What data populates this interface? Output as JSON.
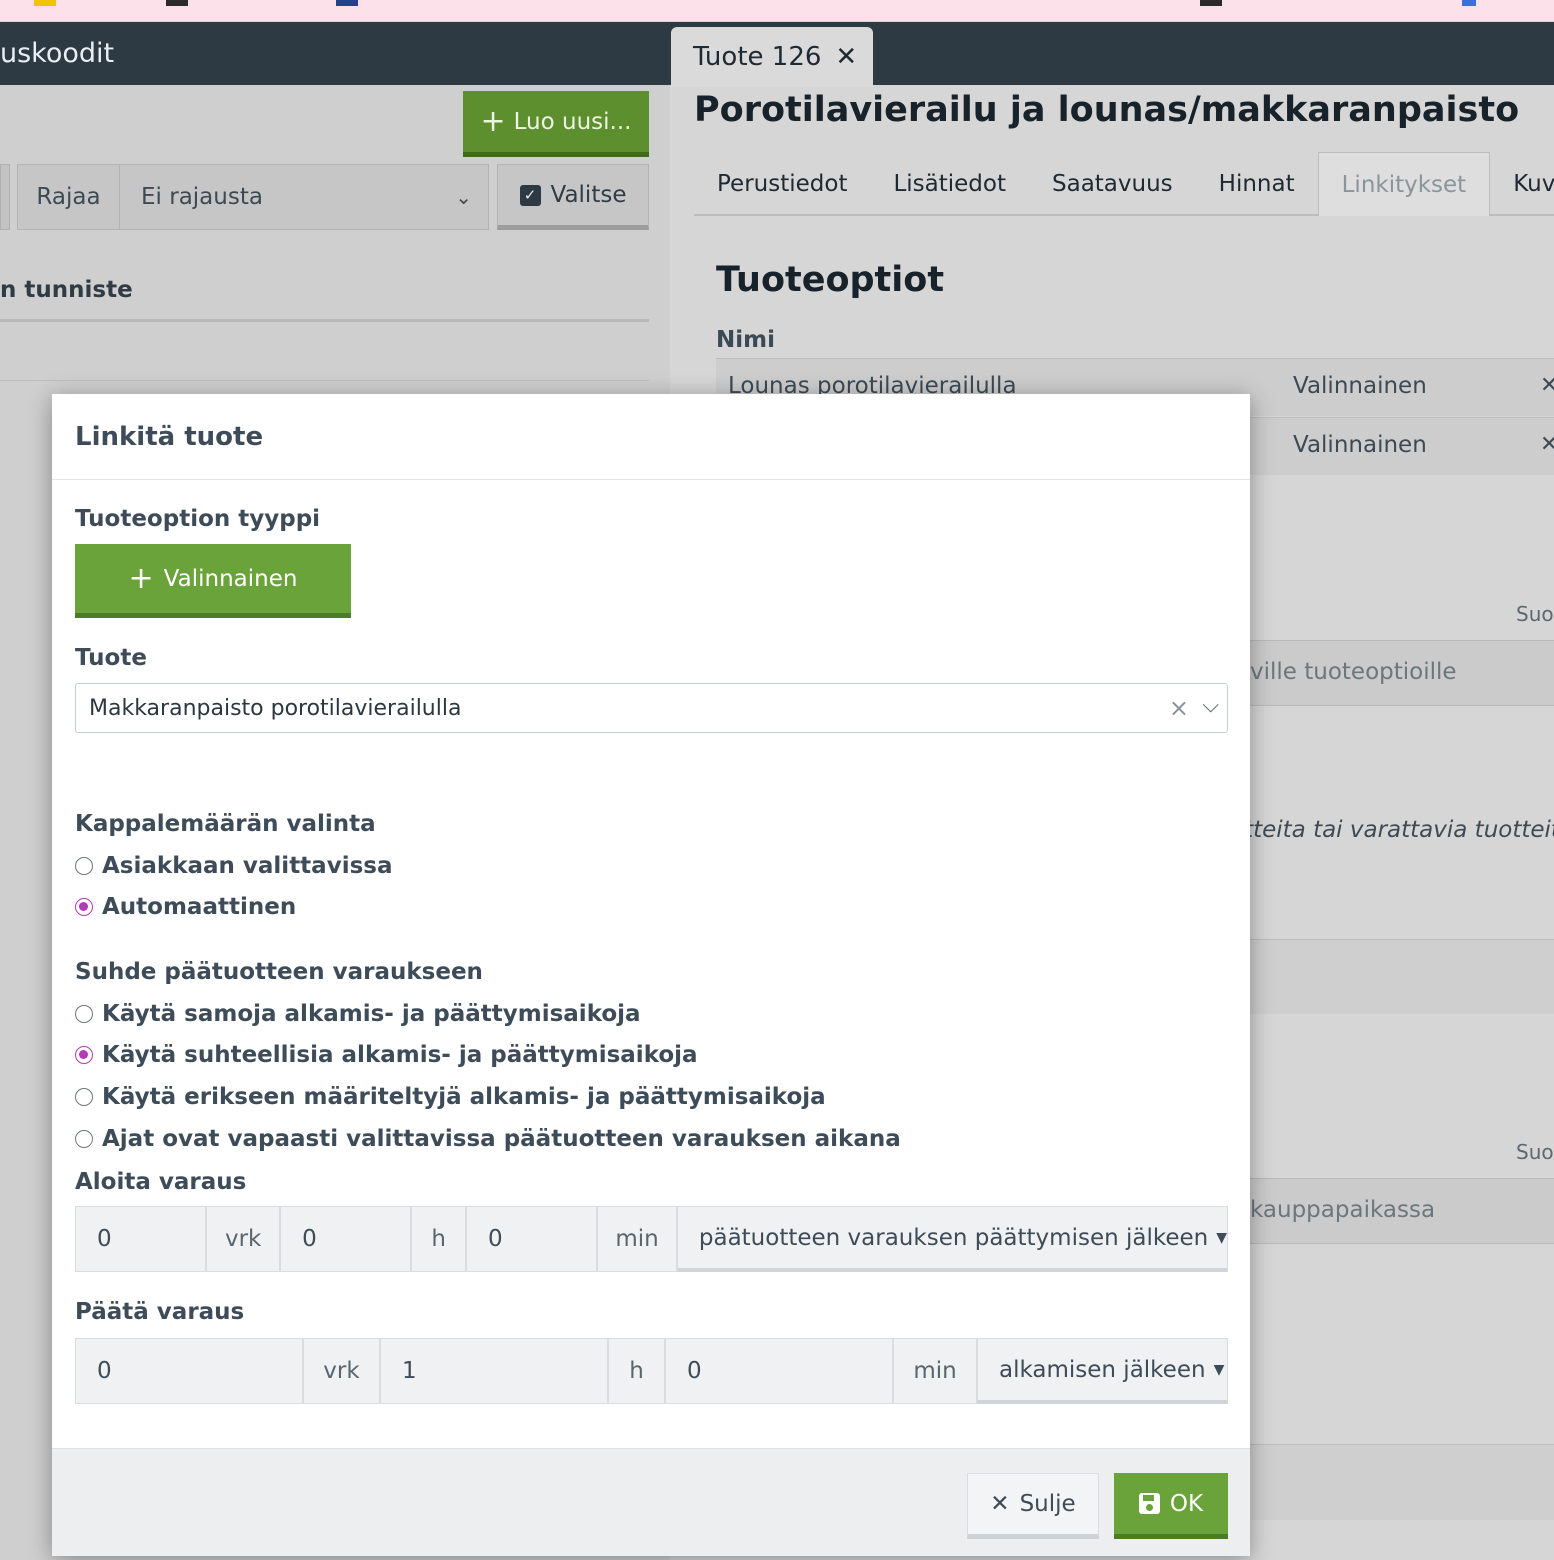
{
  "left": {
    "header_title": "uskoodit",
    "create_button": "Luo uusi...",
    "filter_label": "Rajaa",
    "filter_value": "Ei rajausta",
    "select_button": "Valitse",
    "column_header": "n tunniste"
  },
  "right": {
    "tab_title": "Tuote 126",
    "product_title": "Porotilavierailu ja lounas/makkaranpaisto",
    "tabs": [
      "Perustiedot",
      "Lisätiedot",
      "Saatavuus",
      "Hinnat",
      "Linkitykset",
      "Kuvat"
    ],
    "active_tab": "Linkitykset",
    "section_title": "Tuoteoptiot",
    "col_name": "Nimi",
    "rows": [
      {
        "name": "Lounas porotilavierailulla",
        "type": "Valinnainen"
      },
      {
        "name": "",
        "type": "Valinnainen"
      }
    ],
    "suo_label_1": "Suo",
    "bar_text_1": "ville tuoteoptioille",
    "italic_text": "otteita tai varattavia tuotteita",
    "suo_label_2": "Suo",
    "bar_text_2": "kauppapaikassa"
  },
  "modal": {
    "title": "Linkitä tuote",
    "type_label": "Tuoteoption tyyppi",
    "type_button": "Valinnainen",
    "product_label": "Tuote",
    "product_value": "Makkaranpaisto porotilavierailulla",
    "qty_label": "Kappalemäärän valinta",
    "qty_options": [
      {
        "label": "Asiakkaan valittavissa",
        "selected": false
      },
      {
        "label": "Automaattinen",
        "selected": true
      }
    ],
    "relation_label": "Suhde päätuotteen varaukseen",
    "relation_options": [
      {
        "label": "Käytä samoja alkamis- ja päättymisaikoja",
        "selected": false
      },
      {
        "label": "Käytä suhteellisia alkamis- ja päättymisaikoja",
        "selected": true
      },
      {
        "label": "Käytä erikseen määriteltyjä alkamis- ja päättymisaikoja",
        "selected": false
      },
      {
        "label": "Ajat ovat vapaasti valittavissa päätuotteen varauksen aikana",
        "selected": false
      }
    ],
    "start_label": "Aloita varaus",
    "start": {
      "days": "0",
      "hours": "0",
      "minutes": "0",
      "reference": "päätuotteen varauksen päättymisen jälkeen"
    },
    "end_label": "Päätä varaus",
    "end": {
      "days": "0",
      "hours": "1",
      "minutes": "0",
      "reference": "alkamisen jälkeen"
    },
    "units": {
      "days": "vrk",
      "hours": "h",
      "minutes": "min"
    },
    "close_button": "Sulje",
    "ok_button": "OK"
  },
  "colors": {
    "header_dark": "#2d3a44",
    "primary_green": "#6aa33a",
    "radio_selected": "#b23bb6"
  }
}
